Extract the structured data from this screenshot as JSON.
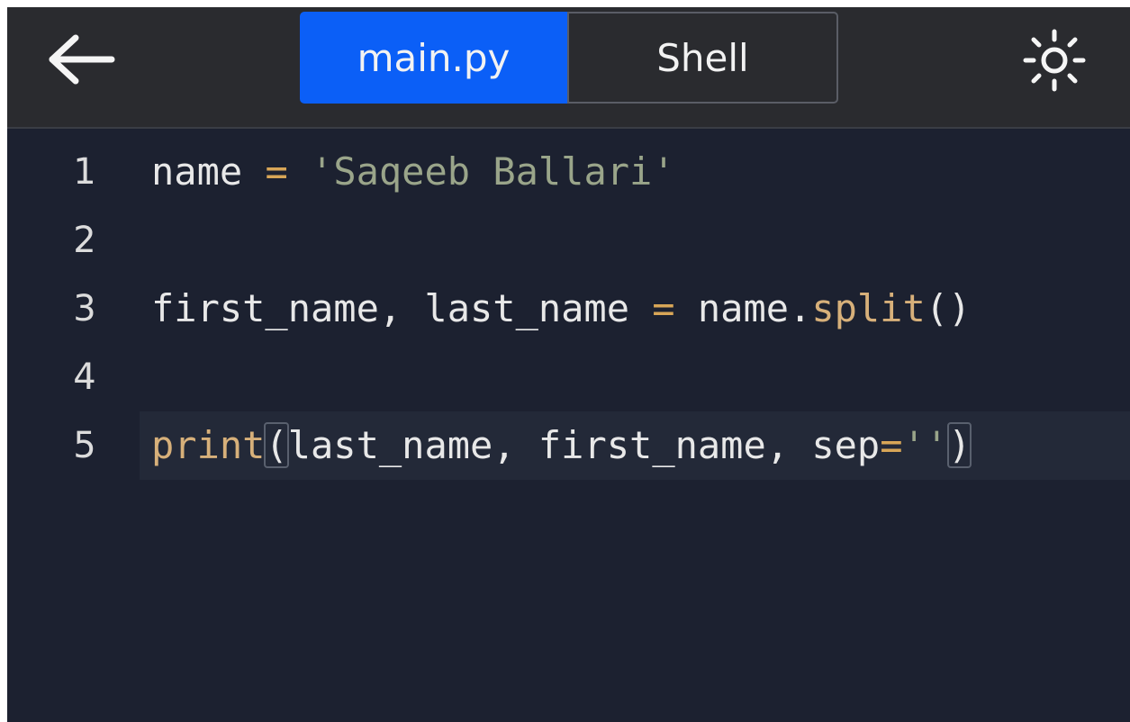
{
  "header": {
    "back_icon": "arrow-left-icon",
    "tabs": [
      {
        "label": "main.py",
        "active": true
      },
      {
        "label": "Shell",
        "active": false
      }
    ],
    "theme_icon": "sun-icon",
    "accent_color": "#0b5ff7"
  },
  "editor": {
    "file": "main.py",
    "current_line": 5,
    "lines": [
      {
        "number": "1",
        "tokens": [
          {
            "t": "name ",
            "k": "plain"
          },
          {
            "t": "=",
            "k": "op"
          },
          {
            "t": " ",
            "k": "plain"
          },
          {
            "t": "'Saqeeb Ballari'",
            "k": "str"
          }
        ]
      },
      {
        "number": "2",
        "tokens": []
      },
      {
        "number": "3",
        "tokens": [
          {
            "t": "first_name, last_name ",
            "k": "plain"
          },
          {
            "t": "=",
            "k": "op"
          },
          {
            "t": " name.",
            "k": "plain"
          },
          {
            "t": "split",
            "k": "fn"
          },
          {
            "t": "()",
            "k": "plain"
          }
        ]
      },
      {
        "number": "4",
        "tokens": []
      },
      {
        "number": "5",
        "tokens": [
          {
            "t": "print",
            "k": "fn"
          },
          {
            "t": "(",
            "k": "bracket"
          },
          {
            "t": "last_name, first_name, sep",
            "k": "plain"
          },
          {
            "t": "=",
            "k": "op"
          },
          {
            "t": "''",
            "k": "str"
          },
          {
            "t": ")",
            "k": "bracket"
          }
        ]
      }
    ]
  }
}
